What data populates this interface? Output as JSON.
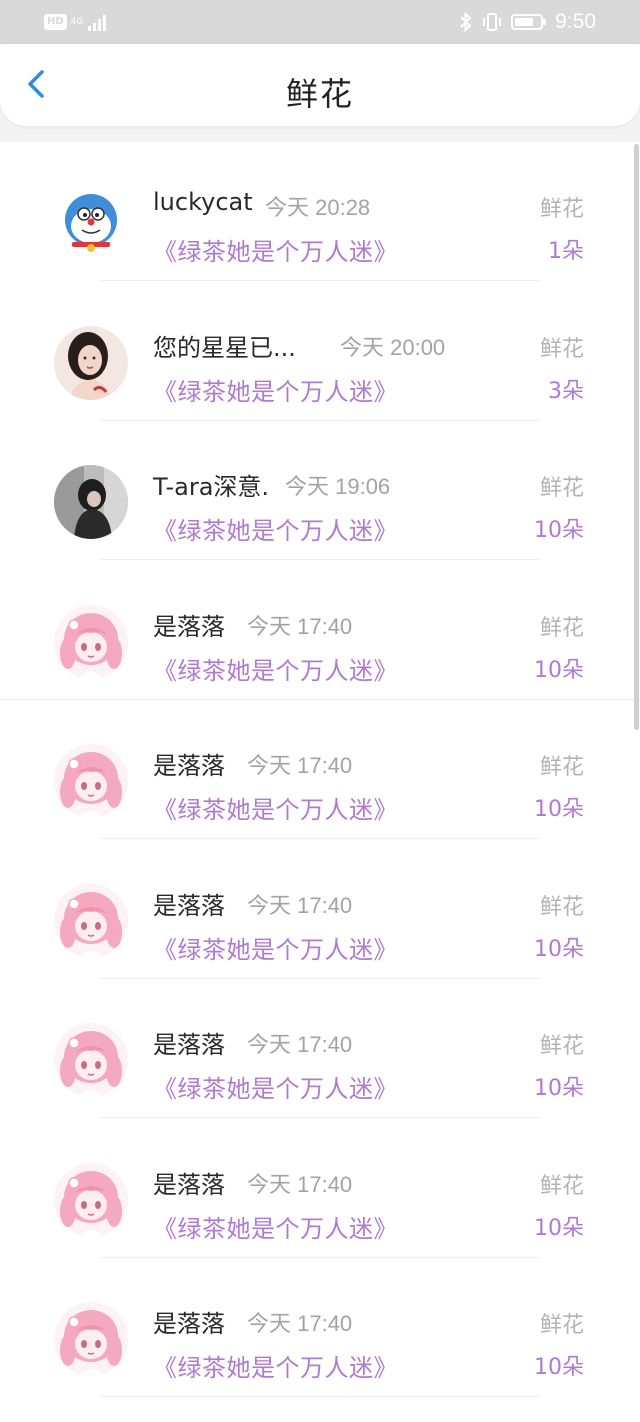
{
  "status_bar": {
    "hd": "HD",
    "network": "4G",
    "time": "9:50"
  },
  "header": {
    "title": "鲜花",
    "back_icon": "chevron-left-icon"
  },
  "rows": [
    {
      "name": "luckycat",
      "time": "今天 20:28",
      "book": "《绿茶她是个万人迷》",
      "gift": "鲜花",
      "count": "1朵",
      "avatar": "cat"
    },
    {
      "name": "您的星星已...",
      "time": "今天 20:00",
      "book": "《绿茶她是个万人迷》",
      "gift": "鲜花",
      "count": "3朵",
      "avatar": "girl"
    },
    {
      "name": "T-ara深意.",
      "time": "今天 19:06",
      "book": "《绿茶她是个万人迷》",
      "gift": "鲜花",
      "count": "10朵",
      "avatar": "photo"
    },
    {
      "name": "是落落",
      "time": "今天 17:40",
      "book": "《绿茶她是个万人迷》",
      "gift": "鲜花",
      "count": "10朵",
      "avatar": "anime"
    },
    {
      "name": "是落落",
      "time": "今天 17:40",
      "book": "《绿茶她是个万人迷》",
      "gift": "鲜花",
      "count": "10朵",
      "avatar": "anime"
    },
    {
      "name": "是落落",
      "time": "今天 17:40",
      "book": "《绿茶她是个万人迷》",
      "gift": "鲜花",
      "count": "10朵",
      "avatar": "anime"
    },
    {
      "name": "是落落",
      "time": "今天 17:40",
      "book": "《绿茶她是个万人迷》",
      "gift": "鲜花",
      "count": "10朵",
      "avatar": "anime"
    },
    {
      "name": "是落落",
      "time": "今天 17:40",
      "book": "《绿茶她是个万人迷》",
      "gift": "鲜花",
      "count": "10朵",
      "avatar": "anime"
    },
    {
      "name": "是落落",
      "time": "今天 17:40",
      "book": "《绿茶她是个万人迷》",
      "gift": "鲜花",
      "count": "10朵",
      "avatar": "anime"
    }
  ],
  "colors": {
    "accent_purple": "#b07ad2",
    "back_blue": "#2b8de0",
    "status_bar": "#d9d9d9"
  }
}
